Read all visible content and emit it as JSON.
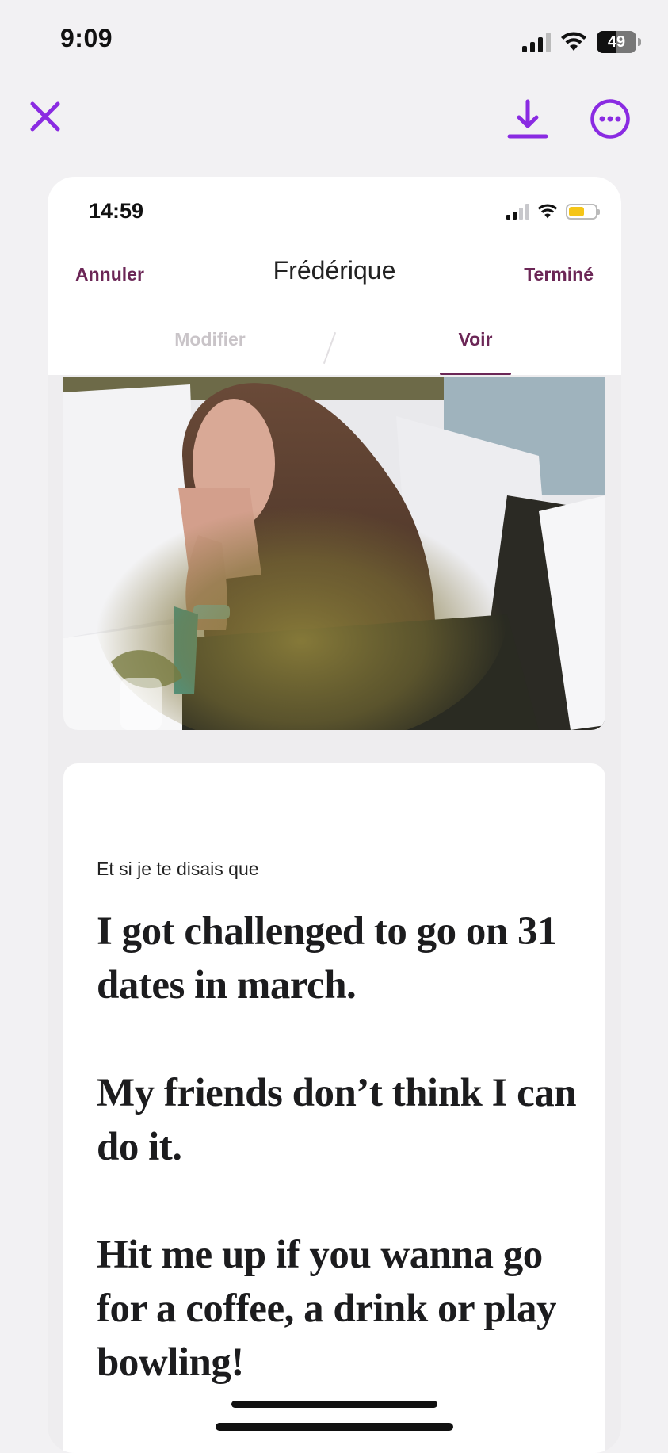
{
  "status_bar": {
    "time": "9:09",
    "battery_level": "49"
  },
  "toolbar": {
    "close_icon": "close-icon",
    "download_icon": "download-icon",
    "more_icon": "more-options-icon",
    "accent_color": "#8a2be2"
  },
  "inner_status_bar": {
    "time": "14:59"
  },
  "inner_nav": {
    "cancel_label": "Annuler",
    "title": "Frédérique",
    "done_label": "Terminé",
    "brand_color": "#6b2656"
  },
  "tabs": [
    {
      "label": "Modifier",
      "active": false
    },
    {
      "label": "Voir",
      "active": true
    }
  ],
  "prompt": {
    "label": "Et si je te disais que",
    "answer_paragraphs": [
      "I got challenged to go on 31 dates in march.",
      "My friends don’t think I can do it.",
      "Hit me up if you wanna go for a coffee, a drink or play bowling!"
    ]
  }
}
